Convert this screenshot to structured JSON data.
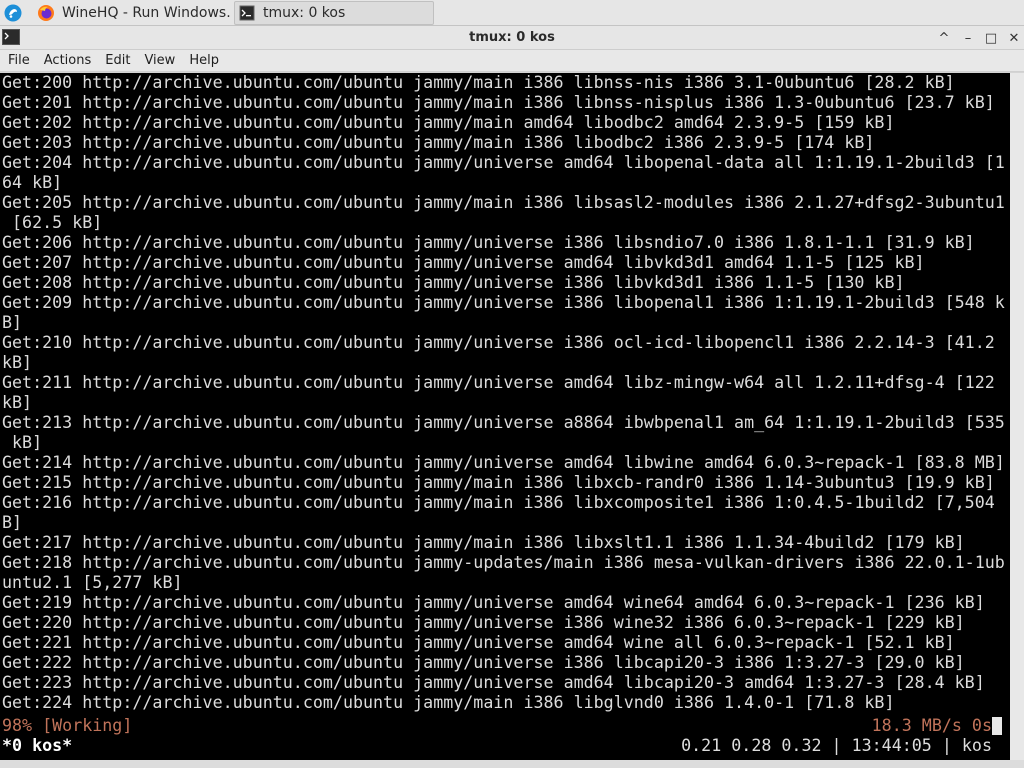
{
  "taskbar": {
    "tasks": [
      {
        "label": "WineHQ - Run Windows...",
        "icon": "firefox-icon"
      },
      {
        "label": "tmux: 0 kos",
        "icon": "terminal-icon"
      }
    ]
  },
  "window": {
    "title": "tmux: 0 kos",
    "controls": [
      "^",
      "–",
      "□",
      "✕"
    ]
  },
  "menu": [
    "File",
    "Actions",
    "Edit",
    "View",
    "Help"
  ],
  "terminal": {
    "lines": [
      "Get:200 http://archive.ubuntu.com/ubuntu jammy/main i386 libnss-nis i386 3.1-0ubuntu6 [28.2 kB]",
      "Get:201 http://archive.ubuntu.com/ubuntu jammy/main i386 libnss-nisplus i386 1.3-0ubuntu6 [23.7 kB]",
      "Get:202 http://archive.ubuntu.com/ubuntu jammy/main amd64 libodbc2 amd64 2.3.9-5 [159 kB]",
      "Get:203 http://archive.ubuntu.com/ubuntu jammy/main i386 libodbc2 i386 2.3.9-5 [174 kB]",
      "Get:204 http://archive.ubuntu.com/ubuntu jammy/universe amd64 libopenal-data all 1:1.19.1-2build3 [1",
      "64 kB]",
      "Get:205 http://archive.ubuntu.com/ubuntu jammy/main i386 libsasl2-modules i386 2.1.27+dfsg2-3ubuntu1",
      " [62.5 kB]",
      "Get:206 http://archive.ubuntu.com/ubuntu jammy/universe i386 libsndio7.0 i386 1.8.1-1.1 [31.9 kB]",
      "Get:207 http://archive.ubuntu.com/ubuntu jammy/universe amd64 libvkd3d1 amd64 1.1-5 [125 kB]",
      "Get:208 http://archive.ubuntu.com/ubuntu jammy/universe i386 libvkd3d1 i386 1.1-5 [130 kB]",
      "Get:209 http://archive.ubuntu.com/ubuntu jammy/universe i386 libopenal1 i386 1:1.19.1-2build3 [548 k",
      "B]",
      "Get:210 http://archive.ubuntu.com/ubuntu jammy/universe i386 ocl-icd-libopencl1 i386 2.2.14-3 [41.2",
      "kB]",
      "Get:211 http://archive.ubuntu.com/ubuntu jammy/universe amd64 libz-mingw-w64 all 1.2.11+dfsg-4 [122",
      "kB]",
      "Get:213 http://archive.ubuntu.com/ubuntu jammy/universe a8864 ibwbpenal1 am_64 1:1.19.1-2build3 [535",
      " kB]",
      "Get:214 http://archive.ubuntu.com/ubuntu jammy/universe amd64 libwine amd64 6.0.3~repack-1 [83.8 MB]",
      "Get:215 http://archive.ubuntu.com/ubuntu jammy/main i386 libxcb-randr0 i386 1.14-3ubuntu3 [19.9 kB]",
      "Get:216 http://archive.ubuntu.com/ubuntu jammy/main i386 libxcomposite1 i386 1:0.4.5-1build2 [7,504",
      "B]",
      "Get:217 http://archive.ubuntu.com/ubuntu jammy/main i386 libxslt1.1 i386 1.1.34-4build2 [179 kB]",
      "Get:218 http://archive.ubuntu.com/ubuntu jammy-updates/main i386 mesa-vulkan-drivers i386 22.0.1-1ub",
      "untu2.1 [5,277 kB]",
      "Get:219 http://archive.ubuntu.com/ubuntu jammy/universe amd64 wine64 amd64 6.0.3~repack-1 [236 kB]",
      "Get:220 http://archive.ubuntu.com/ubuntu jammy/universe i386 wine32 i386 6.0.3~repack-1 [229 kB]",
      "Get:221 http://archive.ubuntu.com/ubuntu jammy/universe amd64 wine all 6.0.3~repack-1 [52.1 kB]",
      "Get:222 http://archive.ubuntu.com/ubuntu jammy/universe i386 libcapi20-3 i386 1:3.27-3 [29.0 kB]",
      "Get:223 http://archive.ubuntu.com/ubuntu jammy/universe amd64 libcapi20-3 amd64 1:3.27-3 [28.4 kB]",
      "Get:224 http://archive.ubuntu.com/ubuntu jammy/main i386 libglvnd0 i386 1.4.0-1 [71.8 kB]"
    ],
    "status_left": "98% [Working]",
    "status_right": "18.3 MB/s 0s",
    "status_color": "#c0735a",
    "tmux_left": "*0 kos*",
    "tmux_right": "0.21 0.28 0.32 | 13:44:05 | kos"
  }
}
